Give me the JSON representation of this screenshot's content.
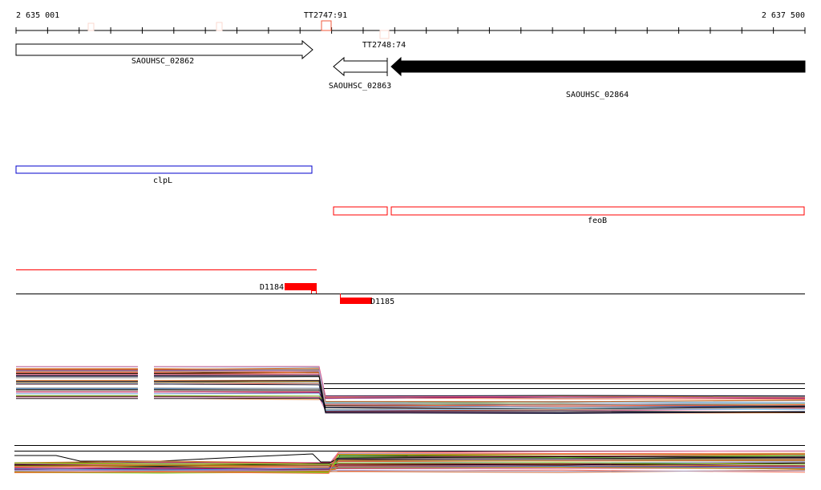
{
  "ruler": {
    "start_label": "2 635 001",
    "end_label": "2 637 500",
    "tick_count": 25
  },
  "markers": [
    {
      "label": "TT2747:91",
      "color": "#f05a3c"
    },
    {
      "label": "TT2748:74",
      "color": "#fbd9cf"
    }
  ],
  "genes": [
    {
      "name": "SAOUHSC_02862",
      "strand": "+",
      "fill": "#ffffff"
    },
    {
      "name": "SAOUHSC_02863",
      "strand": "-",
      "fill": "#ffffff"
    },
    {
      "name": "SAOUHSC_02864",
      "strand": "-",
      "fill": "#000000"
    }
  ],
  "features": [
    {
      "name": "clpL",
      "color": "#0000cc"
    },
    {
      "name": "feoB",
      "color": "#ff0000"
    }
  ],
  "probes": [
    {
      "name": "D1184",
      "color": "#ff0000"
    },
    {
      "name": "D1185",
      "color": "#ff0000"
    }
  ],
  "palette": [
    "#8b1a6b",
    "#c2185b",
    "#7ec8f0",
    "#a8a8d8",
    "#ff6f4f",
    "#b8860b",
    "#d2691e",
    "#9acd32",
    "#6b8e23",
    "#1a1a3a",
    "#66dd22",
    "#e06090",
    "#cc6633",
    "#999999",
    "#4a90d9"
  ]
}
